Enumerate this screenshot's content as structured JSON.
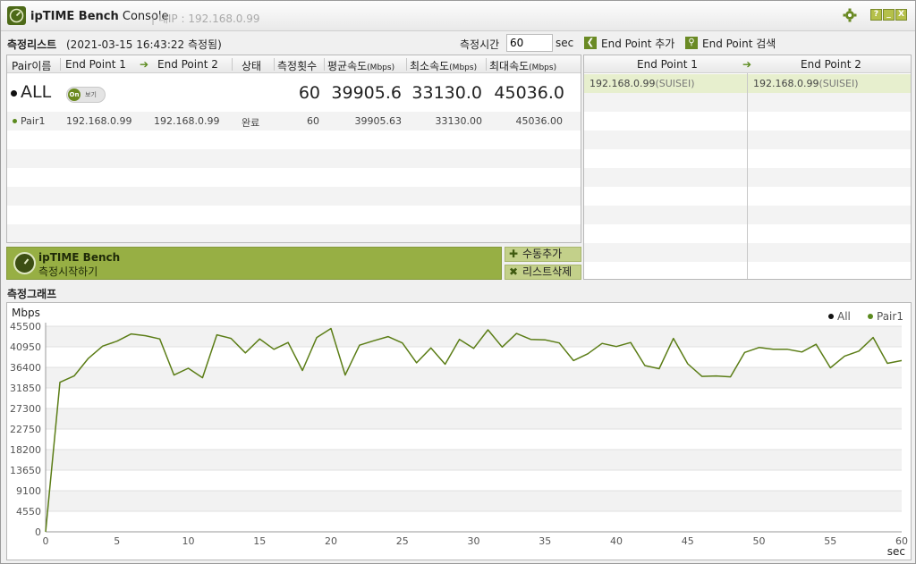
{
  "window": {
    "title_bold": "ipTIME Bench",
    "title_rest": "Console",
    "subtitle": "| 내IP : 192.168.0.99",
    "help_label": "?",
    "min_label": "_",
    "close_label": "X"
  },
  "list": {
    "section_title": "측정리스트",
    "timestamp": "(2021-03-15 16:43:22 측정됨)",
    "time_label": "측정시간",
    "time_value": "60",
    "time_unit": "sec",
    "ep_add_label": "End Point 추가",
    "ep_search_label": "End Point 검색",
    "headers": {
      "pair": "Pair이름",
      "ep1": "End Point 1",
      "ep2": "End Point 2",
      "status": "상태",
      "count": "측정횟수",
      "avg": "평균속도",
      "min": "최소속도",
      "max": "최대속도",
      "unit": "(Mbps)"
    },
    "all_row": {
      "label": "ALL",
      "toggle_on": "On",
      "toggle_text": "보기",
      "count": "60",
      "avg": "39905.6",
      "min": "33130.0",
      "max": "45036.0"
    },
    "rows": [
      {
        "name": "Pair1",
        "ep1": "192.168.0.99",
        "ep2": "192.168.0.99",
        "status": "완료",
        "count": "60",
        "avg": "39905.63",
        "min": "33130.00",
        "max": "45036.00"
      }
    ]
  },
  "bench": {
    "title": "ipTIME Bench",
    "action": "측정시작하기",
    "add_manual": "수동추가",
    "delete_list": "리스트삭제"
  },
  "endpoints": {
    "header1": "End Point 1",
    "header2": "End Point 2",
    "rows": [
      {
        "ep1": "192.168.0.99",
        "ep1_host": "(SUISEI)",
        "ep2": "192.168.0.99",
        "ep2_host": "(SUISEI)"
      }
    ]
  },
  "graph": {
    "section_title": "측정그래프"
  },
  "colors": {
    "accent": "#97af44",
    "line": "#5b7d16",
    "grid_band": "#f2f2f2"
  },
  "chart_data": {
    "type": "line",
    "ylabel": "Mbps",
    "xlabel": "sec",
    "xlim": [
      0,
      60
    ],
    "ylim": [
      0,
      45500
    ],
    "x_ticks": [
      0,
      5,
      10,
      15,
      20,
      25,
      30,
      35,
      40,
      45,
      50,
      55,
      60
    ],
    "y_ticks": [
      0,
      4550,
      9100,
      13650,
      18200,
      22750,
      27300,
      31850,
      36400,
      40950,
      45500
    ],
    "legend": [
      {
        "name": "All",
        "color": "#111111"
      },
      {
        "name": "Pair1",
        "color": "#5b8a1e"
      }
    ],
    "legend_position": "top-right",
    "series": [
      {
        "name": "Pair1",
        "x": [
          0,
          1,
          2,
          3,
          4,
          5,
          6,
          7,
          8,
          9,
          10,
          11,
          12,
          13,
          14,
          15,
          16,
          17,
          18,
          19,
          20,
          21,
          22,
          23,
          24,
          25,
          26,
          27,
          28,
          29,
          30,
          31,
          32,
          33,
          34,
          35,
          36,
          37,
          38,
          39,
          40,
          41,
          42,
          43,
          44,
          45,
          46,
          47,
          48,
          49,
          50,
          51,
          52,
          53,
          54,
          55,
          56,
          57,
          58,
          59,
          60
        ],
        "values": [
          0,
          33100,
          34500,
          38400,
          41100,
          42200,
          43800,
          43400,
          42700,
          34700,
          36200,
          34100,
          43600,
          42800,
          39600,
          42700,
          40400,
          41900,
          35700,
          43000,
          45000,
          34700,
          41300,
          42300,
          43200,
          41800,
          37400,
          40700,
          37100,
          42600,
          40600,
          44700,
          40900,
          43900,
          42600,
          42500,
          41800,
          37900,
          39400,
          41700,
          41000,
          41900,
          36800,
          36100,
          42800,
          37200,
          34400,
          34500,
          34300,
          39700,
          40800,
          40400,
          40400,
          39800,
          41500,
          36300,
          38900,
          40000,
          43000,
          37300,
          37900
        ]
      }
    ]
  }
}
